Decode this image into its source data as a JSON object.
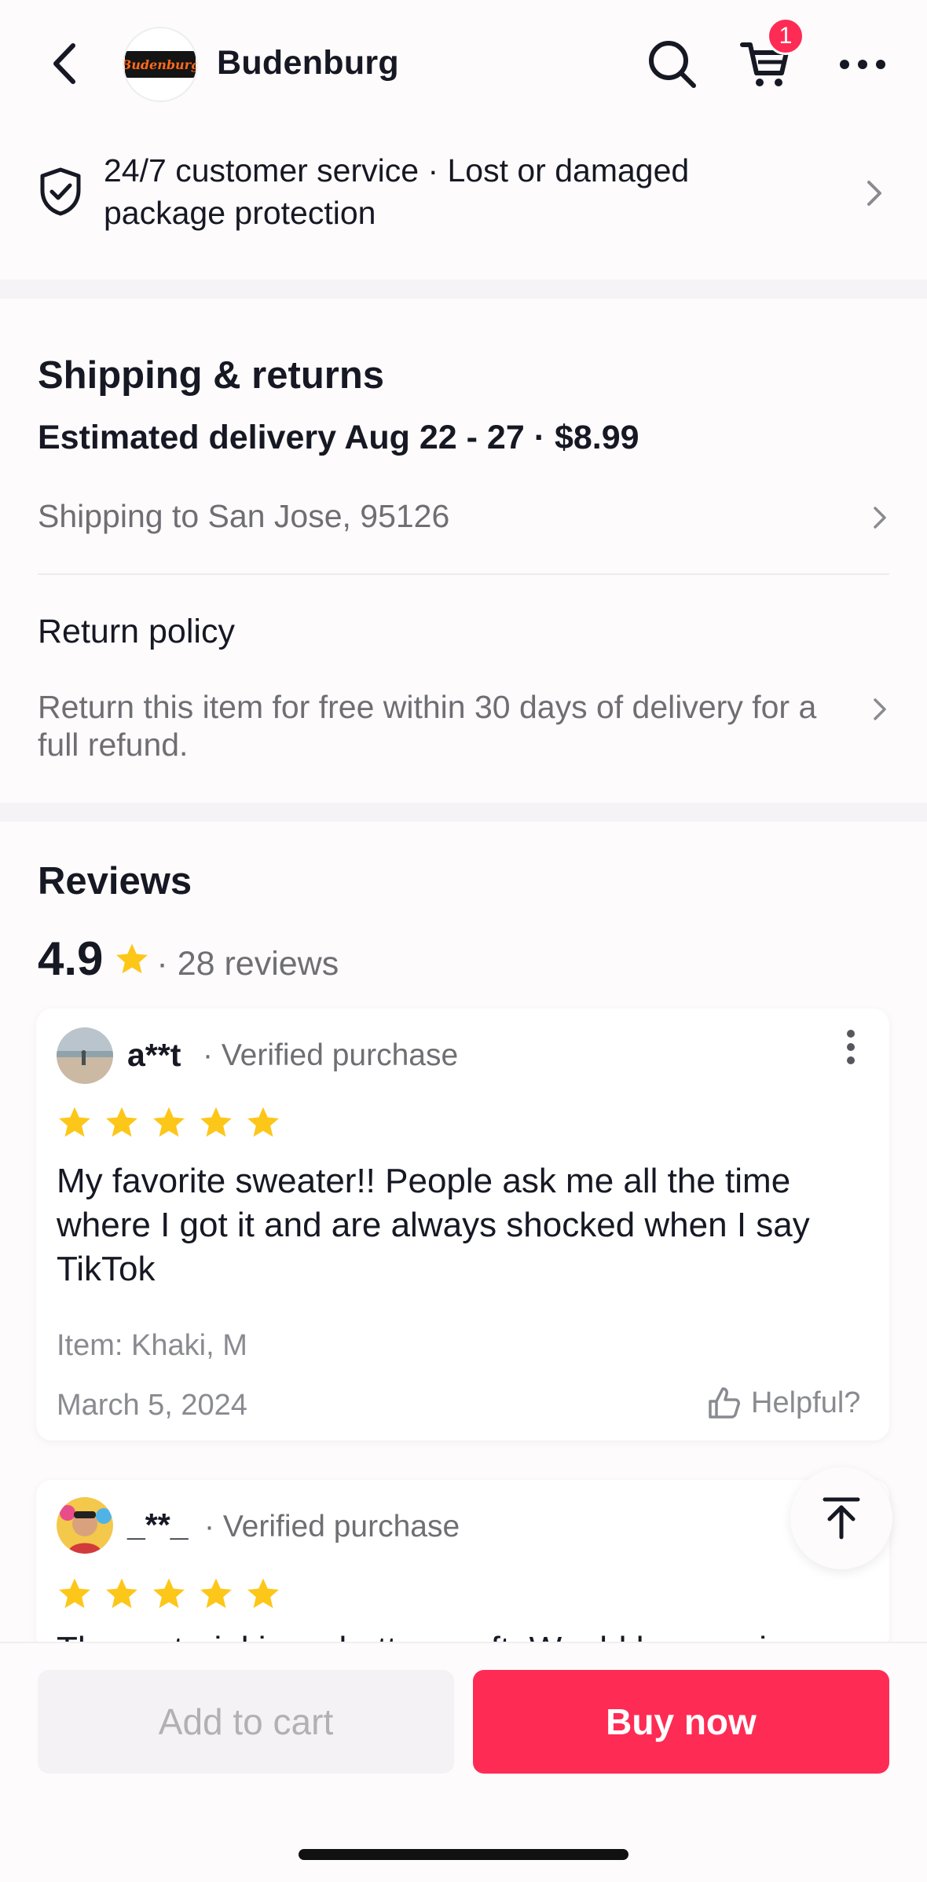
{
  "header": {
    "shop_name": "Budenburg",
    "logo_text": "Budenburg",
    "cart_count": "1"
  },
  "service": {
    "text": "24/7 customer service · Lost or damaged package protection"
  },
  "shipping": {
    "title": "Shipping & returns",
    "estimated": "Estimated delivery Aug 22 - 27 · $8.99",
    "shipping_to": "Shipping to San Jose, 95126",
    "return_title": "Return policy",
    "return_text": "Return this item for free within 30 days of delivery for a full refund."
  },
  "reviews": {
    "title": "Reviews",
    "rating": "4.9",
    "count": "· 28 reviews",
    "items": [
      {
        "name": "a**t",
        "verified": "· Verified purchase",
        "stars": 5,
        "body": "My favorite sweater!! People ask me all the time where I got it and are always shocked when I say TikTok",
        "item": "Item: Khaki, M",
        "date": "March 5, 2024",
        "helpful": "Helpful?"
      },
      {
        "name": "_**_",
        "verified": "· Verified purchase",
        "stars": 5,
        "body": "The material is so buttery soft. Would buy again"
      }
    ]
  },
  "actions": {
    "add_to_cart": "Add to cart",
    "buy_now": "Buy now"
  },
  "colors": {
    "accent": "#fe2c55",
    "star": "#fdc719",
    "muted_text": "#6f6f73"
  },
  "icons": [
    "back-arrow-icon",
    "search-icon",
    "cart-icon",
    "more-icon",
    "shield-check-icon",
    "chevron-right-icon",
    "star-icon",
    "thumbs-up-icon",
    "kebab-menu-icon",
    "scroll-to-top-icon"
  ]
}
